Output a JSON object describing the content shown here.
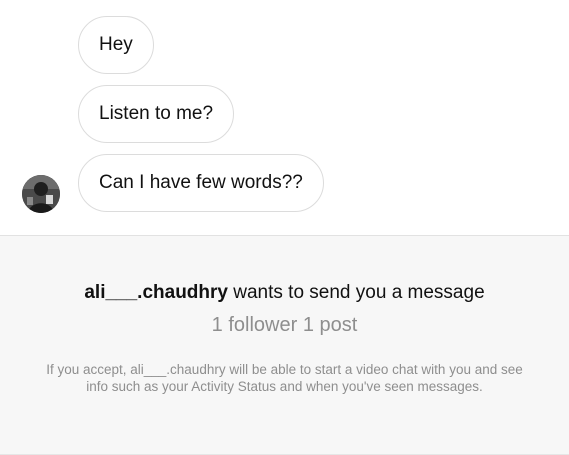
{
  "messages": [
    {
      "text": "Hey"
    },
    {
      "text": "Listen to me?"
    },
    {
      "text": "Can I have few words??"
    }
  ],
  "request": {
    "username": "ali___.chaudhry",
    "title_suffix": " wants to send you a message",
    "stats": "1 follower 1 post",
    "note": "If you accept, ali___.chaudhry will be able to start a video chat with you and see info such as your Activity Status and when you've seen messages."
  }
}
